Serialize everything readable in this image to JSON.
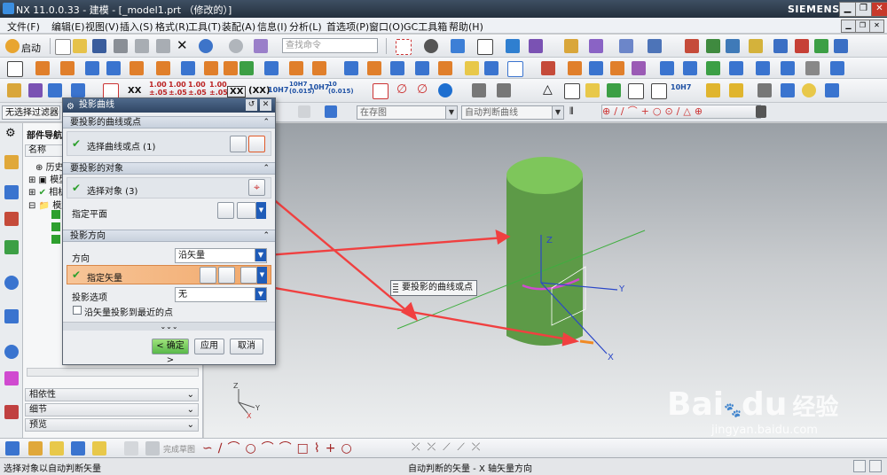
{
  "window": {
    "title": "NX 11.0.0.33 - 建模 - [_model1.prt （修改的）]",
    "brand": "SIEMENS",
    "minimize": "▁",
    "restore": "❐",
    "close": "✕"
  },
  "menubar": {
    "items": [
      "文件(F)",
      "编辑(E)",
      "视图(V)",
      "插入(S)",
      "格式(R)",
      "工具(T)",
      "装配(A)",
      "信息(I)",
      "分析(L)",
      "首选项(P)",
      "窗口(O)",
      "GC工具箱",
      "帮助(H)"
    ]
  },
  "toolbar1": {
    "start_label": "启动",
    "search_placeholder": "查找命令"
  },
  "toolbar3": {
    "dim_labels": [
      "XX",
      "1.00\n±.05",
      "1.00\n±.05",
      "1.00\n±.05",
      "1.00\n±.05",
      "XX",
      "(XX)",
      "10H7",
      "10H7\n(0.015)",
      "10H7",
      "10\n(0.015)"
    ]
  },
  "filterrow": {
    "filter_value": "无选择过滤器",
    "assembly_value": "在存图",
    "snap_value": "自动判断曲线"
  },
  "navigator": {
    "title": "部件导航器",
    "column_name": "名称",
    "tree": [
      "历史",
      "模型",
      "相机",
      "模型",
      "",
      ""
    ],
    "sections": [
      "相依性",
      "细节",
      "预览"
    ]
  },
  "dialog": {
    "title": "投影曲线",
    "group1": "要投影的曲线或点",
    "select_curve": "选择曲线或点 (1)",
    "group2": "要投影的对象",
    "select_object": "选择对象 (3)",
    "specify_plane": "指定平面",
    "group3": "投影方向",
    "direction_label": "方向",
    "direction_value": "沿矢量",
    "specify_vector": "指定矢量",
    "option_label": "投影选项",
    "option_value": "无",
    "nearest_label": "沿矢量投影到最近的点",
    "more": "⌄⌄⌄",
    "ok": "< 确定 >",
    "apply": "应用",
    "cancel": "取消"
  },
  "viewport": {
    "tooltip": "要投影的曲线或点",
    "axis_z": "Z",
    "axis_y": "Y",
    "axis_x": "X",
    "triad_z": "Z",
    "triad_y": "Y",
    "triad_x": "X",
    "watermark_main": "Bai",
    "watermark_paw": "du",
    "watermark_cn": "经验",
    "watermark_url": "jingyan.baidu.com"
  },
  "bottomtoolbar": {
    "sketch_label": "完成草图"
  },
  "statusbar": {
    "left": "选择对象以自动判断矢量",
    "center": "自动判断的矢量 - X 轴矢量方向"
  },
  "colors": {
    "cylinder": "#5d9a47",
    "cylinder_top": "#7ec65b",
    "arrow": "#f04040"
  }
}
